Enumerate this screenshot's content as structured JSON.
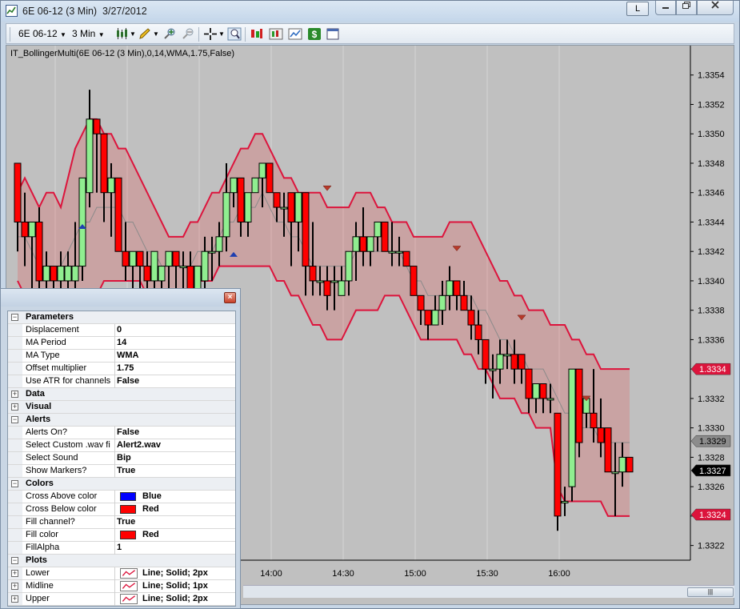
{
  "window": {
    "title": "6E 06-12 (3 Min)  3/27/2012",
    "layout_button": "L"
  },
  "toolbar": {
    "instrument": "6E 06-12",
    "interval": "3 Min"
  },
  "indicator_label": "IT_BollingerMulti(6E 06-12 (3 Min),0,14,WMA,1.75,False)",
  "chart_data": {
    "type": "candlestick",
    "x_ticks": [
      "14:00",
      "14:30",
      "15:00",
      "15:30",
      "16:00"
    ],
    "y_ticks": [
      "1.3354",
      "1.3352",
      "1.3350",
      "1.3348",
      "1.3346",
      "1.3344",
      "1.3342",
      "1.3340",
      "1.3338",
      "1.3336",
      "1.3334",
      "1.3332",
      "1.3330",
      "1.3328",
      "1.3326",
      "1.3324",
      "1.3322"
    ],
    "ylim": [
      1.3321,
      1.3356
    ],
    "price_markers": [
      {
        "label": "1.3334",
        "value": 1.3334,
        "style": "upper"
      },
      {
        "label": "1.3329",
        "value": 1.33291,
        "style": "mid"
      },
      {
        "label": "1.3327",
        "value": 1.33271,
        "style": "last"
      },
      {
        "label": "1.3324",
        "value": 1.33241,
        "style": "lower"
      }
    ],
    "candles": [
      [
        1.3348,
        1.3348,
        1.3342,
        1.3344
      ],
      [
        1.3344,
        1.3346,
        1.3341,
        1.3343
      ],
      [
        1.3343,
        1.3344,
        1.3338,
        1.3344
      ],
      [
        1.3344,
        1.3345,
        1.3339,
        1.334
      ],
      [
        1.334,
        1.3342,
        1.3339,
        1.3341
      ],
      [
        1.3341,
        1.3341,
        1.3338,
        1.334
      ],
      [
        1.334,
        1.3342,
        1.3339,
        1.3341
      ],
      [
        1.334,
        1.3342,
        1.3339,
        1.3341
      ],
      [
        1.334,
        1.3344,
        1.3339,
        1.3341
      ],
      [
        1.3341,
        1.3347,
        1.334,
        1.3347
      ],
      [
        1.3346,
        1.3353,
        1.3345,
        1.3351
      ],
      [
        1.3351,
        1.3351,
        1.3346,
        1.335
      ],
      [
        1.335,
        1.335,
        1.3344,
        1.3346
      ],
      [
        1.3346,
        1.3348,
        1.3343,
        1.3347
      ],
      [
        1.3347,
        1.3347,
        1.3342,
        1.3342
      ],
      [
        1.3342,
        1.3344,
        1.334,
        1.3341
      ],
      [
        1.3341,
        1.3342,
        1.3338,
        1.3342
      ],
      [
        1.3342,
        1.3342,
        1.3339,
        1.3341
      ],
      [
        1.3341,
        1.3342,
        1.3339,
        1.334
      ],
      [
        1.334,
        1.3342,
        1.3339,
        1.3342
      ],
      [
        1.334,
        1.3341,
        1.3339,
        1.3341
      ],
      [
        1.3341,
        1.3342,
        1.3339,
        1.3342
      ],
      [
        1.3342,
        1.3342,
        1.3339,
        1.3341
      ],
      [
        1.3341,
        1.3342,
        1.3337,
        1.3341
      ],
      [
        1.3341,
        1.3342,
        1.3338,
        1.3339
      ],
      [
        1.3339,
        1.3341,
        1.3338,
        1.3341
      ],
      [
        1.334,
        1.3343,
        1.3339,
        1.3342
      ],
      [
        1.3342,
        1.3343,
        1.334,
        1.3342
      ],
      [
        1.3342,
        1.3344,
        1.3341,
        1.3343
      ],
      [
        1.3343,
        1.3348,
        1.3342,
        1.3346
      ],
      [
        1.3346,
        1.3347,
        1.3345,
        1.3347
      ],
      [
        1.3347,
        1.3347,
        1.3343,
        1.3344
      ],
      [
        1.3344,
        1.3346,
        1.3343,
        1.3346
      ],
      [
        1.3346,
        1.3347,
        1.3346,
        1.3347
      ],
      [
        1.3347,
        1.3348,
        1.3345,
        1.3348
      ],
      [
        1.3348,
        1.3348,
        1.3346,
        1.3346
      ],
      [
        1.3346,
        1.3346,
        1.3344,
        1.3345
      ],
      [
        1.3345,
        1.3346,
        1.3343,
        1.3345
      ],
      [
        1.3346,
        1.3346,
        1.3341,
        1.3344
      ],
      [
        1.3344,
        1.3345,
        1.3342,
        1.3346
      ],
      [
        1.3346,
        1.3346,
        1.3339,
        1.3341
      ],
      [
        1.3341,
        1.3344,
        1.3339,
        1.334
      ],
      [
        1.334,
        1.3341,
        1.3339,
        1.334
      ],
      [
        1.334,
        1.3341,
        1.3338,
        1.3339
      ],
      [
        1.334,
        1.3341,
        1.3338,
        1.334
      ],
      [
        1.3339,
        1.3341,
        1.3339,
        1.334
      ],
      [
        1.334,
        1.3342,
        1.3339,
        1.3342
      ],
      [
        1.3342,
        1.3344,
        1.334,
        1.3343
      ],
      [
        1.3343,
        1.3345,
        1.3341,
        1.3342
      ],
      [
        1.3342,
        1.3343,
        1.3341,
        1.3343
      ],
      [
        1.3343,
        1.3344,
        1.3342,
        1.3344
      ],
      [
        1.3344,
        1.3344,
        1.3342,
        1.3342
      ],
      [
        1.3342,
        1.3344,
        1.3341,
        1.3342
      ],
      [
        1.3342,
        1.3343,
        1.3341,
        1.3342
      ],
      [
        1.3342,
        1.3342,
        1.3341,
        1.3341
      ],
      [
        1.3341,
        1.3341,
        1.3339,
        1.3339
      ],
      [
        1.3339,
        1.3339,
        1.3337,
        1.3338
      ],
      [
        1.3338,
        1.3338,
        1.3336,
        1.3337
      ],
      [
        1.3337,
        1.3339,
        1.3337,
        1.3338
      ],
      [
        1.3338,
        1.334,
        1.3337,
        1.3339
      ],
      [
        1.3339,
        1.3341,
        1.3338,
        1.334
      ],
      [
        1.334,
        1.334,
        1.3338,
        1.3339
      ],
      [
        1.3339,
        1.334,
        1.3338,
        1.3338
      ],
      [
        1.3338,
        1.3339,
        1.3336,
        1.3337
      ],
      [
        1.3337,
        1.3338,
        1.3335,
        1.3336
      ],
      [
        1.3336,
        1.3336,
        1.3333,
        1.3334
      ],
      [
        1.3334,
        1.3335,
        1.3332,
        1.3334
      ],
      [
        1.3334,
        1.3336,
        1.3333,
        1.3335
      ],
      [
        1.3335,
        1.3336,
        1.3334,
        1.3335
      ],
      [
        1.3335,
        1.3336,
        1.3333,
        1.3334
      ],
      [
        1.3335,
        1.3335,
        1.3333,
        1.3334
      ],
      [
        1.3334,
        1.3334,
        1.3331,
        1.3332
      ],
      [
        1.3332,
        1.3333,
        1.3331,
        1.3333
      ],
      [
        1.3333,
        1.3333,
        1.3331,
        1.3332
      ],
      [
        1.3332,
        1.3333,
        1.3331,
        1.3332
      ],
      [
        1.3331,
        1.3331,
        1.3323,
        1.3324
      ],
      [
        1.3325,
        1.3326,
        1.3324,
        1.3325
      ],
      [
        1.3326,
        1.3334,
        1.3325,
        1.3334
      ],
      [
        1.3334,
        1.3334,
        1.3328,
        1.3329
      ],
      [
        1.3331,
        1.3332,
        1.333,
        1.3332
      ],
      [
        1.3331,
        1.3334,
        1.3329,
        1.333
      ],
      [
        1.333,
        1.3332,
        1.3328,
        1.3329
      ],
      [
        1.333,
        1.333,
        1.3327,
        1.3327
      ],
      [
        1.3327,
        1.3329,
        1.3324,
        1.3327
      ],
      [
        1.3327,
        1.3329,
        1.3326,
        1.3328
      ],
      [
        1.3328,
        1.3328,
        1.3327,
        1.3327
      ]
    ],
    "upper_band": [
      1.3346,
      1.3347,
      1.3346,
      1.3345,
      1.3346,
      1.3346,
      1.3345,
      1.3347,
      1.3349,
      1.335,
      1.3351,
      1.3351,
      1.335,
      1.335,
      1.3349,
      1.3349,
      1.3348,
      1.3347,
      1.3346,
      1.3345,
      1.3344,
      1.3343,
      1.3343,
      1.3343,
      1.3344,
      1.3344,
      1.3345,
      1.3346,
      1.3346,
      1.3347,
      1.3348,
      1.3349,
      1.3349,
      1.335,
      1.335,
      1.3349,
      1.3348,
      1.3347,
      1.3347,
      1.3346,
      1.3346,
      1.3346,
      1.3346,
      1.3345,
      1.3345,
      1.3345,
      1.3345,
      1.3346,
      1.3346,
      1.3346,
      1.3345,
      1.3345,
      1.3344,
      1.3344,
      1.3344,
      1.3343,
      1.3343,
      1.3343,
      1.3343,
      1.3343,
      1.3344,
      1.3344,
      1.3344,
      1.3344,
      1.3343,
      1.3342,
      1.3341,
      1.334,
      1.334,
      1.3339,
      1.3339,
      1.3338,
      1.3338,
      1.3338,
      1.3337,
      1.3337,
      1.3337,
      1.3336,
      1.3336,
      1.3335,
      1.3335,
      1.3334,
      1.3334,
      1.3334,
      1.3334,
      1.3334
    ],
    "lower_band": [
      1.334,
      1.3339,
      1.3338,
      1.3338,
      1.3338,
      1.3338,
      1.3338,
      1.3338,
      1.3338,
      1.3338,
      1.3339,
      1.3339,
      1.334,
      1.334,
      1.334,
      1.334,
      1.334,
      1.334,
      1.3339,
      1.3339,
      1.3339,
      1.3339,
      1.3339,
      1.3339,
      1.3339,
      1.334,
      1.334,
      1.334,
      1.3341,
      1.3341,
      1.3341,
      1.3341,
      1.3341,
      1.3341,
      1.3341,
      1.3341,
      1.334,
      1.334,
      1.3339,
      1.3339,
      1.3338,
      1.3337,
      1.3337,
      1.3336,
      1.3336,
      1.3336,
      1.3337,
      1.3338,
      1.3338,
      1.3338,
      1.3338,
      1.3339,
      1.3339,
      1.3339,
      1.3338,
      1.3337,
      1.3336,
      1.3336,
      1.3336,
      1.3336,
      1.3336,
      1.3336,
      1.3335,
      1.3335,
      1.3334,
      1.3334,
      1.3333,
      1.3332,
      1.3332,
      1.3332,
      1.3331,
      1.3331,
      1.333,
      1.333,
      1.333,
      1.3326,
      1.3325,
      1.3325,
      1.3325,
      1.3325,
      1.3325,
      1.3325,
      1.3324,
      1.3324,
      1.3324,
      1.3324
    ],
    "mid_line": [
      1.3343,
      1.3343,
      1.3342,
      1.3341,
      1.3341,
      1.3341,
      1.3341,
      1.3342,
      1.3343,
      1.3344,
      1.3344,
      1.3345,
      1.3345,
      1.3345,
      1.3345,
      1.3344,
      1.3344,
      1.3343,
      1.3342,
      1.3342,
      1.3341,
      1.3341,
      1.3341,
      1.3341,
      1.3341,
      1.3342,
      1.3342,
      1.3342,
      1.3343,
      1.3344,
      1.3344,
      1.3345,
      1.3345,
      1.3345,
      1.3346,
      1.3345,
      1.3344,
      1.3344,
      1.3343,
      1.3343,
      1.3342,
      1.3341,
      1.3341,
      1.3341,
      1.3341,
      1.3341,
      1.3341,
      1.3342,
      1.3342,
      1.3342,
      1.3342,
      1.3342,
      1.3342,
      1.3342,
      1.3341,
      1.334,
      1.334,
      1.3339,
      1.3339,
      1.3339,
      1.3339,
      1.3339,
      1.3339,
      1.3339,
      1.3338,
      1.3338,
      1.3337,
      1.3336,
      1.3336,
      1.3335,
      1.3335,
      1.3334,
      1.3334,
      1.3334,
      1.3333,
      1.3332,
      1.3331,
      1.3331,
      1.333,
      1.333,
      1.333,
      1.3329,
      1.3329,
      1.3329,
      1.3329,
      1.3329
    ],
    "cross_markers": [
      {
        "type": "above",
        "bar": 9,
        "value": 1.33437
      },
      {
        "type": "above",
        "bar": 30,
        "value": 1.33418
      },
      {
        "type": "below",
        "bar": 43,
        "value": 1.33463
      },
      {
        "type": "below",
        "bar": 61,
        "value": 1.33422
      },
      {
        "type": "below",
        "bar": 70,
        "value": 1.33375
      },
      {
        "type": "below",
        "bar": 79,
        "value": 1.3332
      }
    ],
    "colors": {
      "up": "#90ee90",
      "down": "#ff0000",
      "band": "#dc143c",
      "fill": "rgba(255,0,0,0.15)",
      "mid": "#8a8a8a",
      "cross_above": "#1f3fb0",
      "cross_below": "#b83a2a"
    }
  },
  "properties": {
    "categories": [
      {
        "name": "Parameters",
        "expanded": true,
        "items": [
          {
            "key": "Displacement",
            "value": "0"
          },
          {
            "key": "MA Period",
            "value": "14"
          },
          {
            "key": "MA Type",
            "value": "WMA"
          },
          {
            "key": "Offset multiplier",
            "value": "1.75"
          },
          {
            "key": "Use ATR for channels",
            "value": "False"
          }
        ]
      },
      {
        "name": "Data",
        "expanded": false,
        "items": []
      },
      {
        "name": "Visual",
        "expanded": false,
        "items": []
      },
      {
        "name": "Alerts",
        "expanded": true,
        "items": [
          {
            "key": "Alerts On?",
            "value": "False"
          },
          {
            "key": "Select Custom .wav fi",
            "value": "Alert2.wav"
          },
          {
            "key": "Select Sound",
            "value": "Bip"
          },
          {
            "key": "Show Markers?",
            "value": "True"
          }
        ]
      },
      {
        "name": "Colors",
        "expanded": true,
        "items": [
          {
            "key": "Cross Above color",
            "value": "Blue",
            "swatch": "#0000ff"
          },
          {
            "key": "Cross Below color",
            "value": "Red",
            "swatch": "#ff0000"
          },
          {
            "key": "Fill channel?",
            "value": "True"
          },
          {
            "key": "Fill color",
            "value": "Red",
            "swatch": "#ff0000"
          },
          {
            "key": "FillAlpha",
            "value": "1"
          }
        ]
      },
      {
        "name": "Plots",
        "expanded": true,
        "items": [
          {
            "key": "Lower",
            "value": "Line; Solid; 2px",
            "line": true
          },
          {
            "key": "Midline",
            "value": "Line; Solid; 1px",
            "line": true
          },
          {
            "key": "Upper",
            "value": "Line; Solid; 2px",
            "line": true
          }
        ]
      }
    ]
  },
  "scrollbar": {
    "thumb": "|||"
  }
}
